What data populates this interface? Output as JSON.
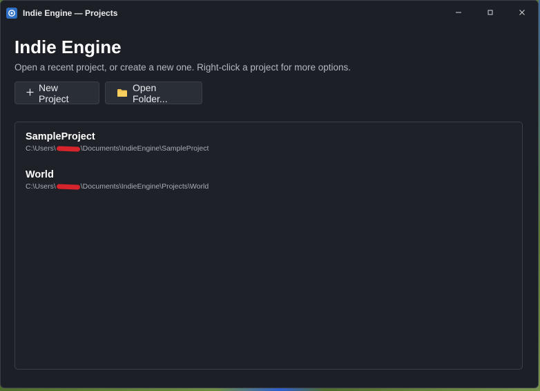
{
  "window": {
    "title": "Indie Engine — Projects",
    "controls": {
      "minimize": "—",
      "maximize": "◻",
      "close": "✕"
    }
  },
  "header": {
    "title": "Indie Engine",
    "subtitle": "Open a recent project, or create a new one. Right-click a project for more options."
  },
  "actions": {
    "new_project_label": "New Project",
    "new_project_icon": "plus-icon",
    "open_folder_label": "Open Folder...",
    "open_folder_icon": "folder-icon"
  },
  "projects": [
    {
      "name": "SampleProject",
      "path_prefix": "C:\\Users\\",
      "path_suffix": "\\Documents\\IndieEngine\\SampleProject"
    },
    {
      "name": "World",
      "path_prefix": "C:\\Users\\",
      "path_suffix": "\\Documents\\IndieEngine\\Projects\\World"
    }
  ],
  "colors": {
    "window_bg": "#1c1f26",
    "button_bg": "#2a2e36",
    "folder": "#f2c14e",
    "redaction": "#d5242b",
    "app_icon": "#2f6fc5"
  }
}
